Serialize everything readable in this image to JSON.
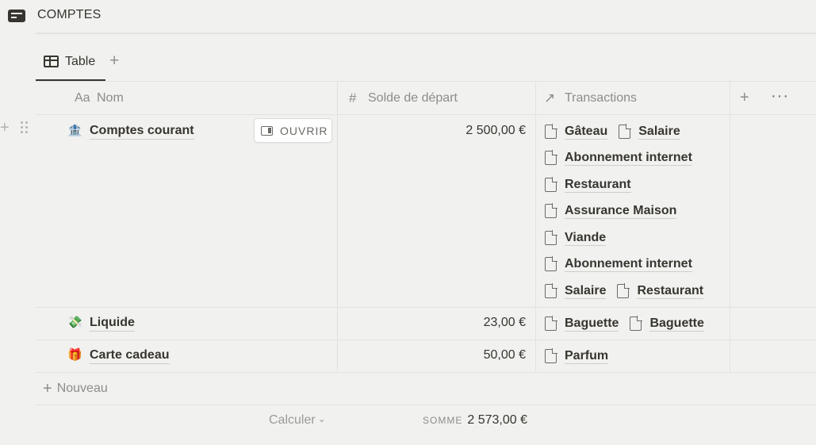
{
  "database": {
    "title": "COMPTES",
    "icon": "database-icon"
  },
  "views": {
    "tabs": [
      {
        "label": "Table",
        "icon": "table-icon"
      }
    ],
    "add_view_icon": "plus-icon"
  },
  "columns": {
    "nom": {
      "type_label": "Aa",
      "label": "Nom"
    },
    "solde": {
      "type_icon": "#",
      "label": "Solde de départ"
    },
    "transactions": {
      "type_icon": "↗",
      "label": "Transactions"
    },
    "add_icon": "+",
    "more_icon": "···"
  },
  "rows": [
    {
      "emoji": "🏦",
      "name": "Comptes courant",
      "amount": "2 500,00 €",
      "open_label": "OUVRIR",
      "transactions": [
        [
          "Gâteau",
          "Salaire"
        ],
        [
          "Abonnement internet"
        ],
        [
          "Restaurant"
        ],
        [
          "Assurance Maison"
        ],
        [
          "Viande"
        ],
        [
          "Abonnement internet"
        ],
        [
          "Salaire",
          "Restaurant"
        ]
      ]
    },
    {
      "emoji": "💸",
      "name": "Liquide",
      "amount": "23,00 €",
      "transactions": [
        [
          "Baguette",
          "Baguette"
        ]
      ]
    },
    {
      "emoji": "🎁",
      "name": "Carte cadeau",
      "amount": "50,00 €",
      "transactions": [
        [
          "Parfum"
        ]
      ]
    }
  ],
  "footer": {
    "new_label": "Nouveau",
    "calc_label": "Calculer",
    "sum_label": "SOMME",
    "sum_value": "2 573,00 €"
  },
  "colors": {
    "background": "#f1f1ef",
    "text": "#37352f",
    "muted": "#8d8c88",
    "border": "#e3e2de"
  }
}
